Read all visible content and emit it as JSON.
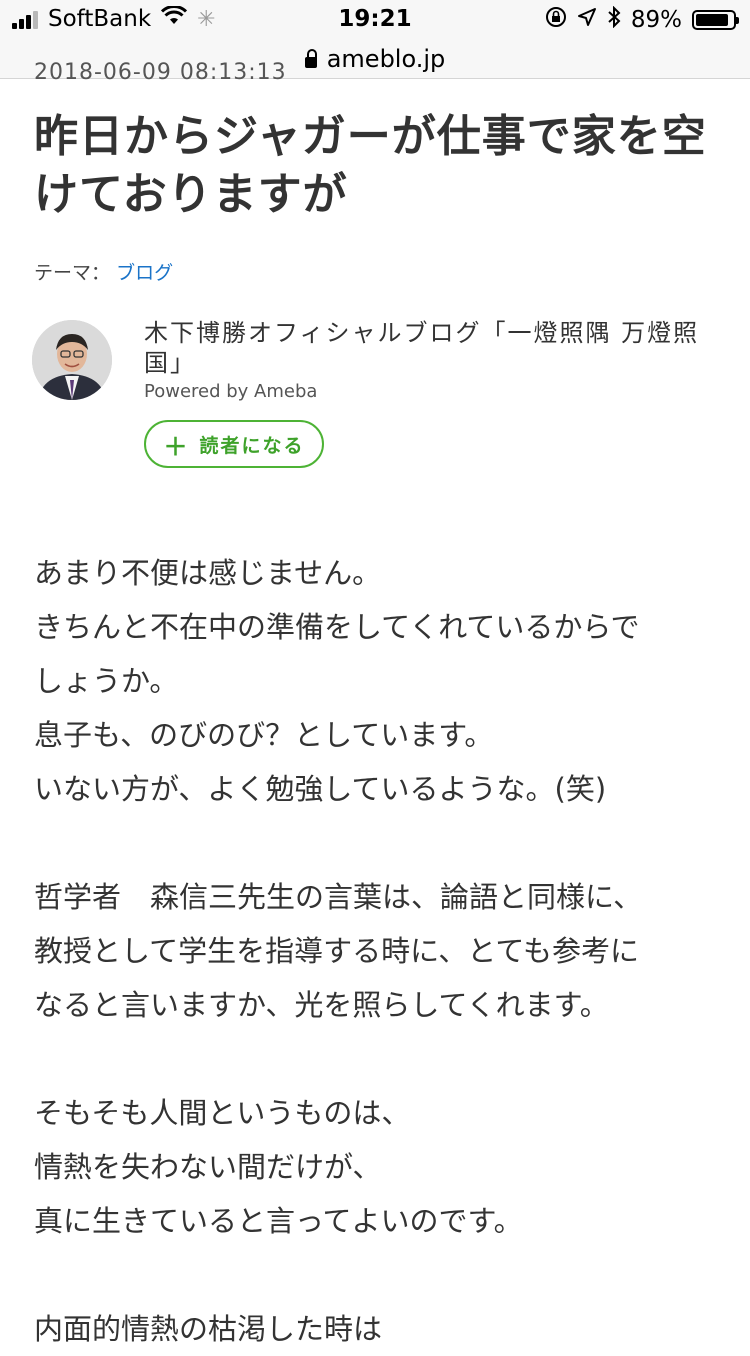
{
  "status_bar": {
    "carrier": "SoftBank",
    "time": "19:21",
    "battery_percent": "89%",
    "battery_level": 0.89,
    "icons": [
      "signal-icon",
      "wifi-icon",
      "activity-spinner-icon",
      "rotation-lock-icon",
      "location-arrow-icon",
      "bluetooth-icon",
      "battery-icon"
    ]
  },
  "url_bar": {
    "domain": "ameblo.jp"
  },
  "article": {
    "date_partial": "2018-06-09 08:13:13",
    "title": "昨日からジャガーが仕事で家を空けておりますが",
    "theme_label": "テーマ：",
    "theme_value": "ブログ",
    "blog_name": "木下博勝オフィシャルブログ「一燈照隅 万燈照国」",
    "powered_by": "Powered by Ameba",
    "follow_label": "読者になる",
    "paragraphs": [
      [
        "あまり不便は感じません。",
        "きちんと不在中の準備をしてくれているからで",
        "しょうか。",
        "息子も、のびのび？としています。",
        "いない方が、よく勉強しているような。(笑)"
      ],
      [
        "哲学者　森信三先生の言葉は、論語と同様に、",
        "教授として学生を指導する時に、とても参考に",
        "なると言いますか、光を照らしてくれます。"
      ],
      [
        "そもそも人間というものは、",
        "情熱を失わない間だけが、",
        "真に生きていると言ってよいのです。"
      ],
      [
        "内面的情熱の枯渇した時は"
      ]
    ]
  },
  "colors": {
    "accent_green": "#4db335",
    "link_blue": "#1a73c8",
    "text": "#333333"
  }
}
